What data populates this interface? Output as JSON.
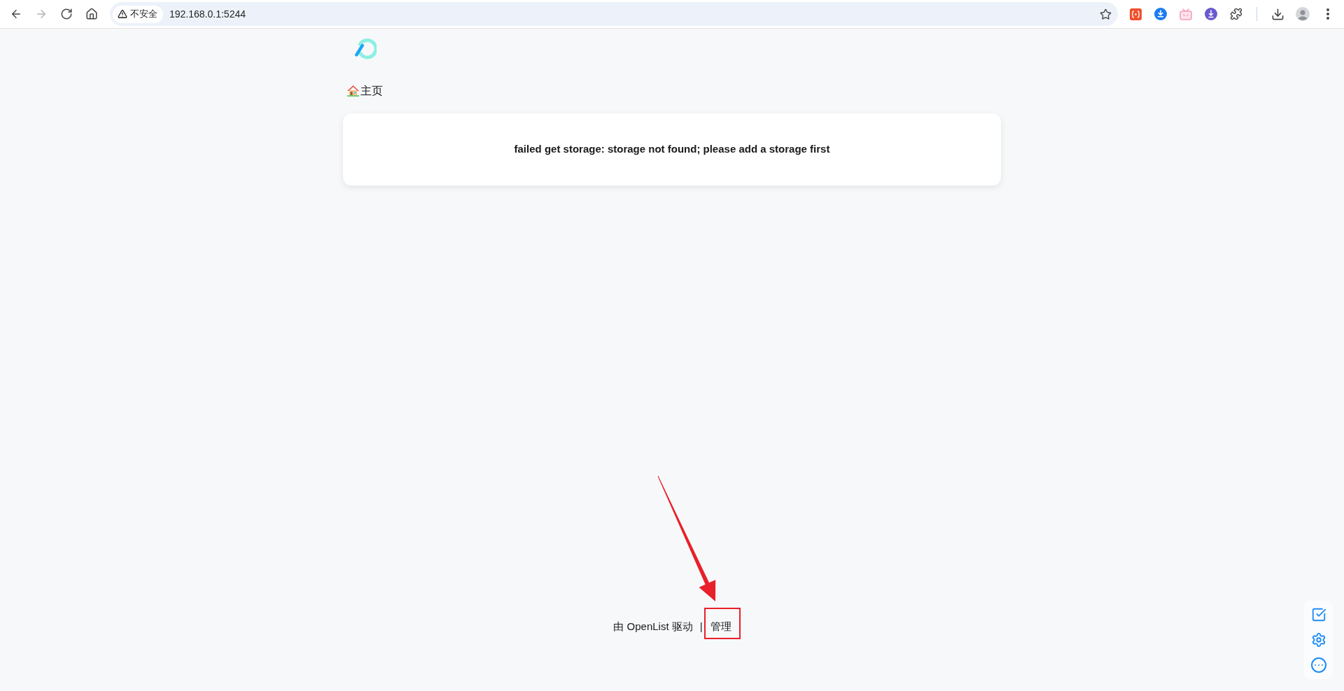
{
  "browser": {
    "nav_buttons": [
      {
        "kind": "back",
        "disabled": false
      },
      {
        "kind": "forward",
        "disabled": true
      },
      {
        "kind": "reload",
        "disabled": false
      },
      {
        "kind": "home",
        "disabled": false
      }
    ],
    "security_chip": "不安全",
    "url": "192.168.0.1:5244"
  },
  "breadcrumb": [
    {
      "label": "主页"
    }
  ],
  "message": "failed get storage: storage not found; please add a storage first",
  "footer": {
    "powered_by": "由 OpenList 驱动",
    "separator": "|",
    "manage_link": "管理"
  }
}
